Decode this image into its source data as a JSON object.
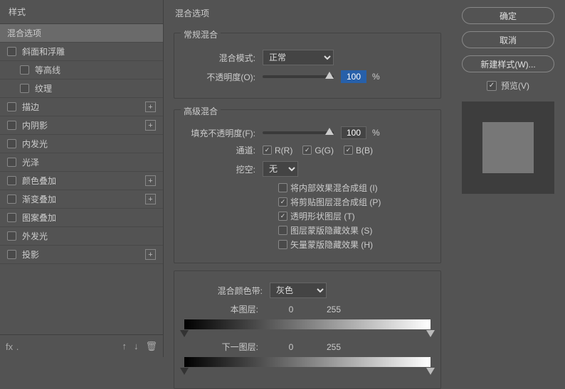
{
  "left": {
    "header": "样式",
    "items": [
      {
        "label": "混合选项",
        "selected": true
      },
      {
        "label": "斜面和浮雕",
        "checked": false,
        "add": false
      },
      {
        "label": "等高线",
        "checked": false,
        "sub": true
      },
      {
        "label": "纹理",
        "checked": false,
        "sub": true
      },
      {
        "label": "描边",
        "checked": false,
        "add": true
      },
      {
        "label": "内阴影",
        "checked": false,
        "add": true
      },
      {
        "label": "内发光",
        "checked": false
      },
      {
        "label": "光泽",
        "checked": false
      },
      {
        "label": "颜色叠加",
        "checked": false,
        "add": true
      },
      {
        "label": "渐变叠加",
        "checked": false,
        "add": true
      },
      {
        "label": "图案叠加",
        "checked": false
      },
      {
        "label": "外发光",
        "checked": false
      },
      {
        "label": "投影",
        "checked": false,
        "add": true
      }
    ],
    "footer": {
      "fx": "fx﹒",
      "up": "↑",
      "down": "↓",
      "trash": "🗑"
    }
  },
  "center": {
    "title": "混合选项",
    "basic": {
      "title": "常规混合",
      "mode_label": "混合模式:",
      "mode_value": "正常",
      "opacity_label": "不透明度(O):",
      "opacity_value": "100",
      "pct": "%"
    },
    "advanced": {
      "title": "高级混合",
      "fill_label": "填充不透明度(F):",
      "fill_value": "100",
      "pct": "%",
      "channel_label": "通道:",
      "R": "R(R)",
      "G": "G(G)",
      "B": "B(B)",
      "knockout_label": "挖空:",
      "knockout_value": "无",
      "opts": [
        {
          "label": "将内部效果混合成组 (I)",
          "checked": false
        },
        {
          "label": "将剪贴图层混合成组 (P)",
          "checked": true
        },
        {
          "label": "透明形状图层 (T)",
          "checked": true
        },
        {
          "label": "图层蒙版隐藏效果 (S)",
          "checked": false
        },
        {
          "label": "矢量蒙版隐藏效果 (H)",
          "checked": false
        }
      ]
    },
    "blendif": {
      "label": "混合颜色带:",
      "value": "灰色",
      "this_label": "本图层:",
      "this_v0": "0",
      "this_v1": "255",
      "under_label": "下一图层:",
      "under_v0": "0",
      "under_v1": "255"
    }
  },
  "right": {
    "ok": "确定",
    "cancel": "取消",
    "new_style": "新建样式(W)...",
    "preview": "预览(V)"
  }
}
